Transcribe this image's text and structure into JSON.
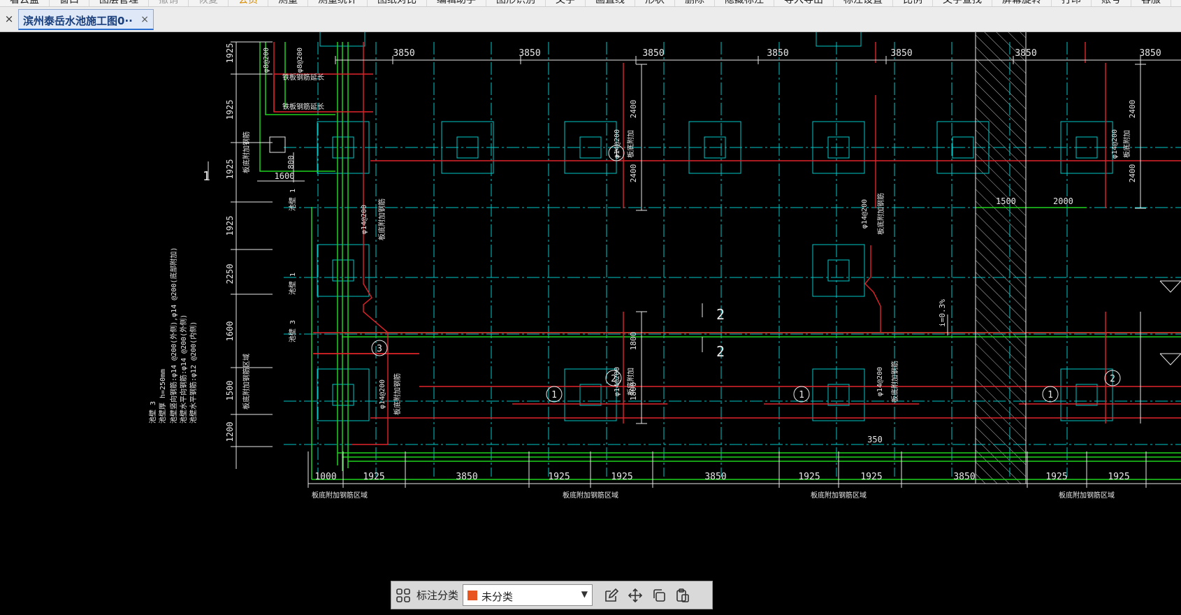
{
  "menubar": {
    "items": [
      {
        "label": "看云盘",
        "state": "normal"
      },
      {
        "label": "窗口",
        "state": "normal"
      },
      {
        "label": "图层管理",
        "state": "normal"
      },
      {
        "label": "撤销",
        "state": "disabled"
      },
      {
        "label": "恢复",
        "state": "disabled"
      },
      {
        "label": "会员",
        "state": "accent"
      },
      {
        "label": "测量",
        "state": "normal"
      },
      {
        "label": "测量统计",
        "state": "normal"
      },
      {
        "label": "图纸对比",
        "state": "normal"
      },
      {
        "label": "编辑助手",
        "state": "normal"
      },
      {
        "label": "图形识别",
        "state": "normal"
      },
      {
        "label": "文字",
        "state": "normal"
      },
      {
        "label": "画直线",
        "state": "normal"
      },
      {
        "label": "形状",
        "state": "normal"
      },
      {
        "label": "删除",
        "state": "normal"
      },
      {
        "label": "隐藏标注",
        "state": "normal"
      },
      {
        "label": "导入导出",
        "state": "normal"
      },
      {
        "label": "标注设置",
        "state": "normal"
      },
      {
        "label": "比例",
        "state": "normal"
      },
      {
        "label": "文字查找",
        "state": "normal"
      },
      {
        "label": "屏幕旋转",
        "state": "normal"
      },
      {
        "label": "打印",
        "state": "normal"
      },
      {
        "label": "账号",
        "state": "normal"
      },
      {
        "label": "客服",
        "state": "normal"
      }
    ]
  },
  "tabs": {
    "close_all": "×",
    "active_tab": {
      "title": "滨州泰岳水池施工图0··",
      "close": "×"
    }
  },
  "drawing": {
    "colors": {
      "cyan": "#00c8c8",
      "red": "#e0242a",
      "green": "#1ed21e",
      "white": "#e8e8e8",
      "hatch": "#bdbdbd"
    },
    "top_dims": [
      "3850",
      "3850",
      "3850",
      "3850",
      "3850",
      "3850",
      "3850"
    ],
    "bottom_dims": [
      "1000",
      "1925",
      "3850",
      "1925",
      "1925",
      "3850",
      "1925",
      "1925",
      "3850",
      "1925",
      "1925"
    ],
    "bottom_notes": [
      "板底附加钢筋区域",
      "板底附加钢筋区域",
      "板底附加钢筋区域",
      "板底附加钢筋区域"
    ],
    "left_dims": [
      "1925",
      "1925",
      "1925",
      "1925",
      "2250",
      "1600",
      "1500",
      "1200"
    ],
    "left_notes": [
      "池壁 3",
      "池壁厚 h=250mm",
      "池壁竖向钢筋:φ14 @200(外侧),φ14 @200(底部附加)",
      "池壁水平向钢筋:φ14 @200(外侧)",
      "池壁水平钢筋:φ12 @200(内侧)"
    ],
    "wall_labels": [
      "池壁 1",
      "池壁 1",
      "池壁 3"
    ],
    "rebar_texts": {
      "phi8_200": "φ8@200",
      "phi14_200": "φ14@200",
      "bottom_add": "板底附加",
      "bottom_add_bars": "板底附加钢筋",
      "bottom_add_area": "板底附加钢筋区域",
      "iron_bar": "铁板钢筋延长"
    },
    "misc_dims": {
      "d800": "800",
      "d1600": "1600",
      "d1500": "1500",
      "d2000": "2000",
      "d2400": "2400",
      "d1800": "1800",
      "d350": "350",
      "slope": "i=0.3%"
    },
    "section_marks": [
      "2",
      "2",
      "1",
      "1"
    ],
    "circle_marks": [
      "1",
      "1",
      "1",
      "1",
      "2",
      "2",
      "2",
      "3"
    ]
  },
  "floatbar": {
    "label": "标注分类",
    "select_value": "未分类",
    "select_color": "#e8551f",
    "icons": [
      "grid-icon",
      "edit-icon",
      "move-icon",
      "copy-icon",
      "paste-icon"
    ]
  }
}
